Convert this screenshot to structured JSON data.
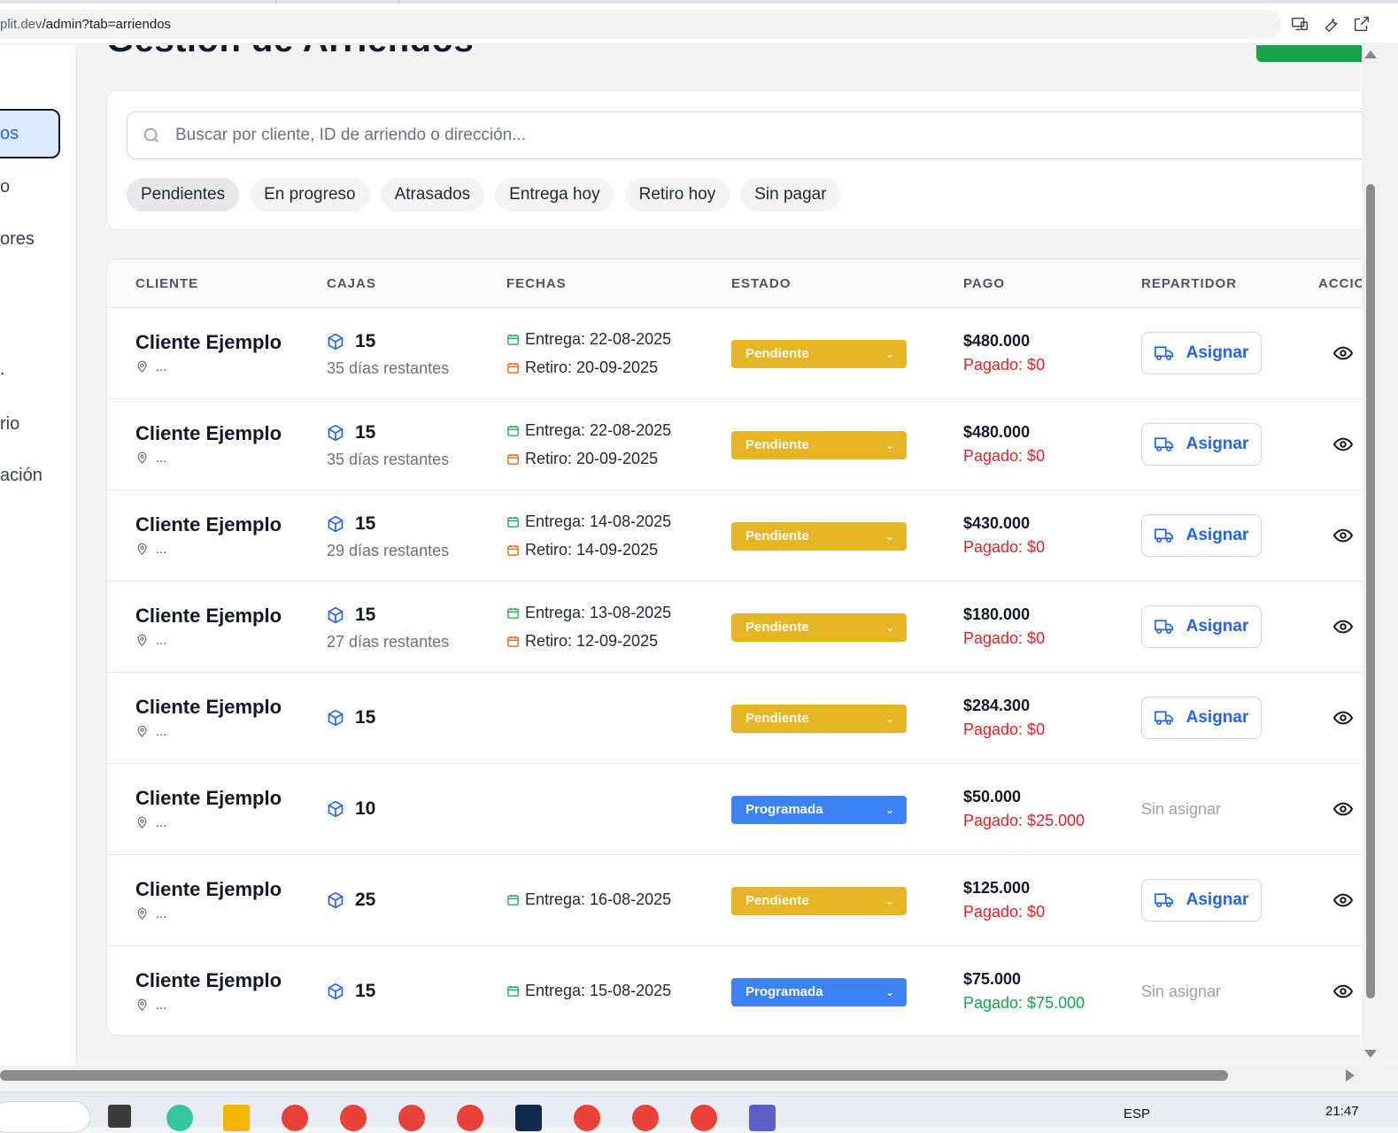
{
  "browser": {
    "url_prefix": "plit.dev",
    "url_path": "/admin?tab=arriendos"
  },
  "sidebar": {
    "items": [
      {
        "label": "os",
        "active": true
      },
      {
        "label": "o"
      },
      {
        "label": "ores"
      },
      {
        "label": "."
      },
      {
        "label": "rio"
      },
      {
        "label": "ación"
      }
    ]
  },
  "page": {
    "title": "Gestión de Arriendos"
  },
  "search": {
    "placeholder": "Buscar por cliente, ID de arriendo o dirección..."
  },
  "filters": [
    "Pendientes",
    "En progreso",
    "Atrasados",
    "Entrega hoy",
    "Retiro hoy",
    "Sin pagar"
  ],
  "table": {
    "headers": {
      "cliente": "CLIENTE",
      "cajas": "CAJAS",
      "fechas": "FECHAS",
      "estado": "ESTADO",
      "pago": "PAGO",
      "repartidor": "REPARTIDOR",
      "acciones": "ACCIC"
    },
    "assign_label": "Asignar",
    "unassigned_label": "Sin asignar",
    "rows": [
      {
        "client": "Cliente Ejemplo",
        "address": "...",
        "boxes": "15",
        "days": "35 días restantes",
        "delivery": "Entrega: 22-08-2025",
        "pickup": "Retiro: 20-09-2025",
        "status": "Pendiente",
        "amount": "$480.000",
        "paid": "Pagado: $0"
      },
      {
        "client": "Cliente Ejemplo",
        "address": "...",
        "boxes": "15",
        "days": "35 días restantes",
        "delivery": "Entrega: 22-08-2025",
        "pickup": "Retiro: 20-09-2025",
        "status": "Pendiente",
        "amount": "$480.000",
        "paid": "Pagado: $0"
      },
      {
        "client": "Cliente Ejemplo",
        "address": "...",
        "boxes": "15",
        "days": "29 días restantes",
        "delivery": "Entrega: 14-08-2025",
        "pickup": "Retiro: 14-09-2025",
        "status": "Pendiente",
        "amount": "$430.000",
        "paid": "Pagado: $0"
      },
      {
        "client": "Cliente Ejemplo",
        "address": "...",
        "boxes": "15",
        "days": "27 días restantes",
        "delivery": "Entrega: 13-08-2025",
        "pickup": "Retiro: 12-09-2025",
        "status": "Pendiente",
        "amount": "$180.000",
        "paid": "Pagado: $0"
      },
      {
        "client": "Cliente Ejemplo",
        "address": "...",
        "boxes": "15",
        "status": "Pendiente",
        "amount": "$284.300",
        "paid": "Pagado: $0"
      },
      {
        "client": "Cliente Ejemplo",
        "address": "...",
        "boxes": "10",
        "status": "Programada",
        "amount": "$50.000",
        "paid": "Pagado: $25.000"
      },
      {
        "client": "Cliente Ejemplo",
        "address": "...",
        "boxes": "25",
        "delivery": "Entrega: 16-08-2025",
        "status": "Pendiente",
        "amount": "$125.000",
        "paid": "Pagado: $0"
      },
      {
        "client": "Cliente Ejemplo",
        "address": "...",
        "boxes": "15",
        "delivery": "Entrega: 15-08-2025",
        "status": "Programada",
        "amount": "$75.000",
        "paid": "Pagado: $75.000"
      }
    ]
  },
  "taskbar": {
    "lang": "ESP",
    "time": "21:47"
  },
  "colors": {
    "pending": "#e5b525",
    "scheduled": "#3b82f6",
    "accent": "#2563eb",
    "paid_none": "#dc2626",
    "paid_full": "#16a34a"
  }
}
